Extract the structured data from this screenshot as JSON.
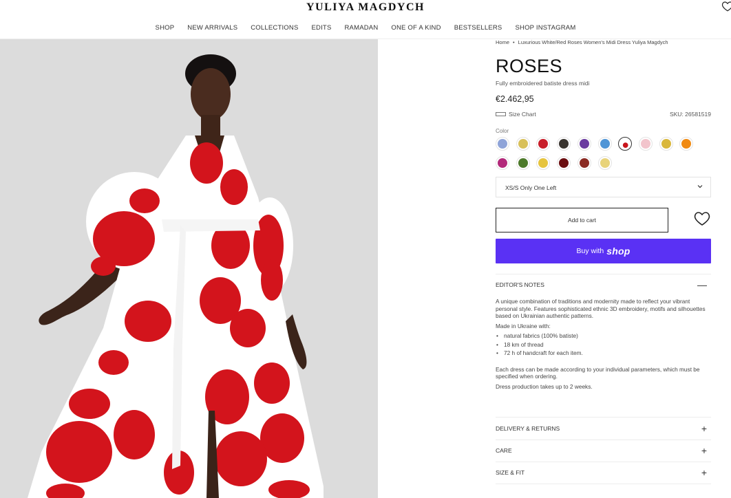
{
  "brand": "YULIYA MAGDYCH",
  "nav": [
    "SHOP",
    "NEW ARRIVALS",
    "COLLECTIONS",
    "EDITS",
    "RAMADAN",
    "ONE OF A KIND",
    "BESTSELLERS",
    "SHOP INSTAGRAM"
  ],
  "breadcrumb": {
    "home": "Home",
    "sep": "•",
    "current": "Luxurious White/Red Roses Women's Midi Dress Yuliya Magdych"
  },
  "product": {
    "title": "ROSES",
    "subtitle": "Fully embroidered batiste dress midi",
    "price": "€2.462,95",
    "size_chart": "Size Chart",
    "sku": "SKU: 26581519"
  },
  "color_label": "Color",
  "swatch_colors": [
    "#8fa4d8",
    "#d8c05a",
    "#c81e2a",
    "#3a3530",
    "#6b3ca0",
    "#4f95d6",
    "#ffffff",
    "#f2c4cc",
    "#d9b73c",
    "#f08a12",
    "#b2297a",
    "#4d7a2b",
    "#e6c43e",
    "#6a0d10",
    "#8a2a22",
    "#e8d37a"
  ],
  "size_select": "XS/S Only One Left",
  "add_to_cart": "Add to cart",
  "buy_with": "Buy with",
  "shop_logo": "shop",
  "editor_notes": {
    "title": "EDITOR'S NOTES",
    "toggle": "—",
    "intro": "A unique combination of traditions and modernity made to reflect your vibrant personal style. Features sophisticated ethnic 3D embroidery, motifs and silhouettes based on Ukrainian authentic patterns.",
    "made_in": "Made in Ukraine with:",
    "bullets": [
      "natural fabrics (100% batiste)",
      "18 km of thread",
      "72 h of handcraft for each item."
    ],
    "custom": "Each dress can be made according to your individual parameters, which must be specified when ordering.",
    "production": "Dress production takes up to 2 weeks."
  },
  "sections": [
    {
      "title": "DELIVERY & RETURNS",
      "toggle": "+"
    },
    {
      "title": "CARE",
      "toggle": "+"
    },
    {
      "title": "SIZE & FIT",
      "toggle": "+"
    }
  ]
}
